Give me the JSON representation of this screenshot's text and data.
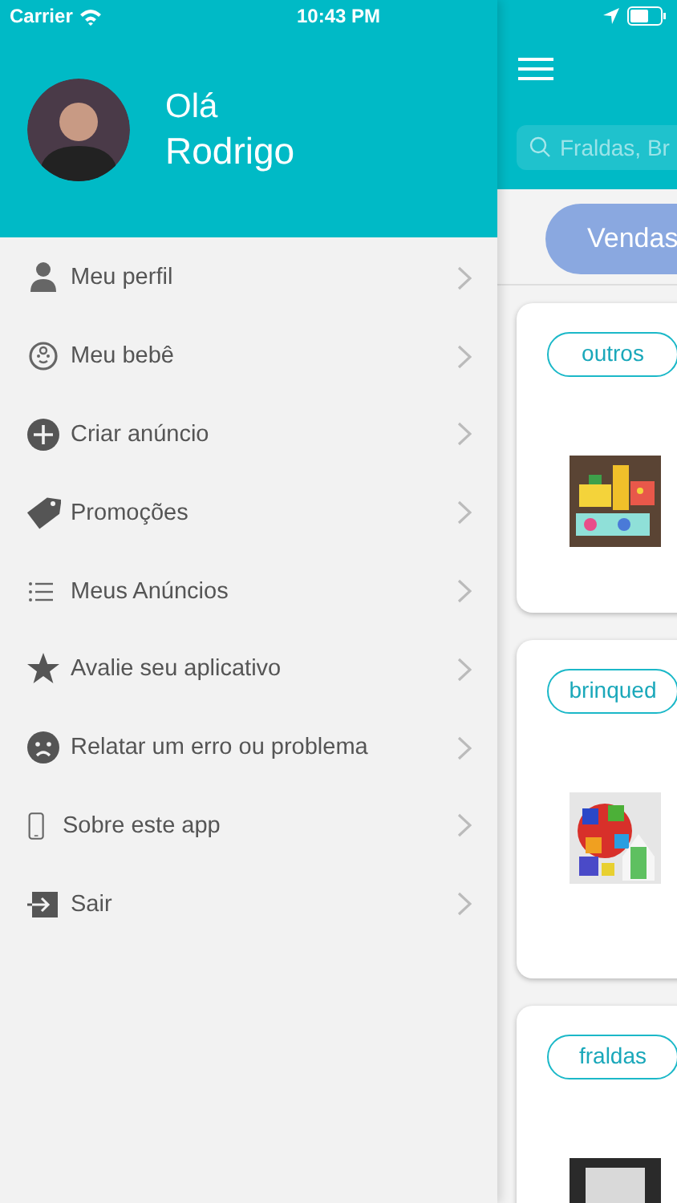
{
  "status_bar": {
    "carrier": "Carrier",
    "time": "10:43 PM"
  },
  "drawer": {
    "greeting": "Olá",
    "user_name": "Rodrigo",
    "menu": [
      {
        "label": "Meu perfil",
        "kind": "person"
      },
      {
        "label": "Meu bebê",
        "kind": "baby"
      },
      {
        "label": "Criar anúncio",
        "kind": "plus"
      },
      {
        "label": "Promoções",
        "kind": "tag"
      },
      {
        "label": "Meus Anúncios",
        "kind": "list"
      },
      {
        "label": "Avalie seu aplicativo",
        "kind": "star"
      },
      {
        "label": "Relatar um erro ou problema",
        "kind": "sad"
      },
      {
        "label": "Sobre este app",
        "kind": "phone"
      },
      {
        "label": "Sair",
        "kind": "exit"
      }
    ]
  },
  "main": {
    "search": {
      "placeholder": "Fraldas, Br"
    },
    "filter_tab": {
      "label": "Vendas",
      "selected": true
    },
    "listings": [
      {
        "tag": "outros",
        "kind": "picture"
      },
      {
        "tag": "brinqued",
        "kind": "picture"
      },
      {
        "tag": "fraldas",
        "kind": "picture"
      }
    ]
  }
}
